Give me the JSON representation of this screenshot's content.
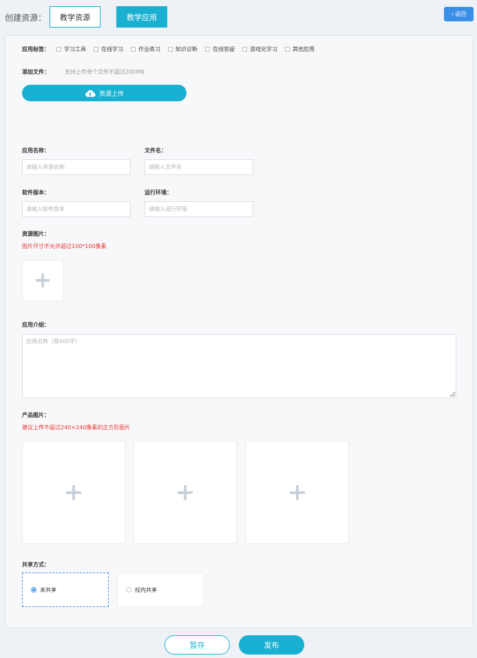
{
  "header": {
    "create_label": "创建资源：",
    "tab_resource": "教学资源",
    "tab_app": "教学应用",
    "back_label": "返回"
  },
  "form": {
    "tags_label": "应用标签：",
    "tags": [
      "学习工具",
      "在线学习",
      "作业练习",
      "知识诊断",
      "在线答疑",
      "游戏化学习",
      "其他应用"
    ],
    "file_label": "添加文件：",
    "file_hint": "支持上传单个文件不超过200MB",
    "upload_label": "资源上传",
    "app_name_label": "应用名称：",
    "app_name_placeholder": "请输入资源名称",
    "file_name_label": "文件名：",
    "file_name_placeholder": "请输入文件名",
    "version_label": "软件版本：",
    "version_placeholder": "请输入软件版本",
    "env_label": "运行环境：",
    "env_placeholder": "请输入运行环境",
    "res_image_label": "资源图片：",
    "res_image_hint": "图片尺寸不允许超过100*100像素",
    "intro_label": "应用介绍：",
    "intro_placeholder": "应用名称（限400字）",
    "product_image_label": "产品图片：",
    "product_image_hint": "建议上传不超过240×240像素的正方形图片",
    "share_label": "共享方式：",
    "share_none": "未共享",
    "share_school": "校内共享"
  },
  "footer": {
    "save_label": "暂存",
    "publish_label": "发布"
  },
  "colors": {
    "accent": "#19b0d1",
    "back_button": "#3a8ee6",
    "hint_red": "#e8332d"
  }
}
